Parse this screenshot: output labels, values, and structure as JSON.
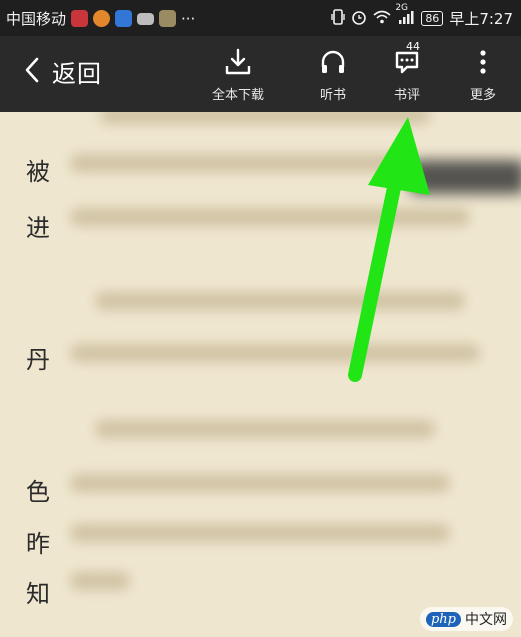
{
  "status_bar": {
    "carrier": "中国移动",
    "more": "···",
    "network_tag": "2G",
    "battery": "86",
    "time": "早上7:27"
  },
  "toolbar": {
    "back_label": "返回",
    "items": [
      {
        "label": "全本下载",
        "icon": "download-icon"
      },
      {
        "label": "听书",
        "icon": "headphones-icon"
      },
      {
        "label": "书评",
        "icon": "comment-icon",
        "count": "44"
      },
      {
        "label": "更多",
        "icon": "more-vertical-icon"
      }
    ]
  },
  "content": {
    "side_chars": [
      "被",
      "进",
      "丹",
      "色",
      "昨",
      "知"
    ]
  },
  "annotation": {
    "color": "#22e515"
  },
  "watermark": {
    "php": "php",
    "site": "中文网"
  }
}
